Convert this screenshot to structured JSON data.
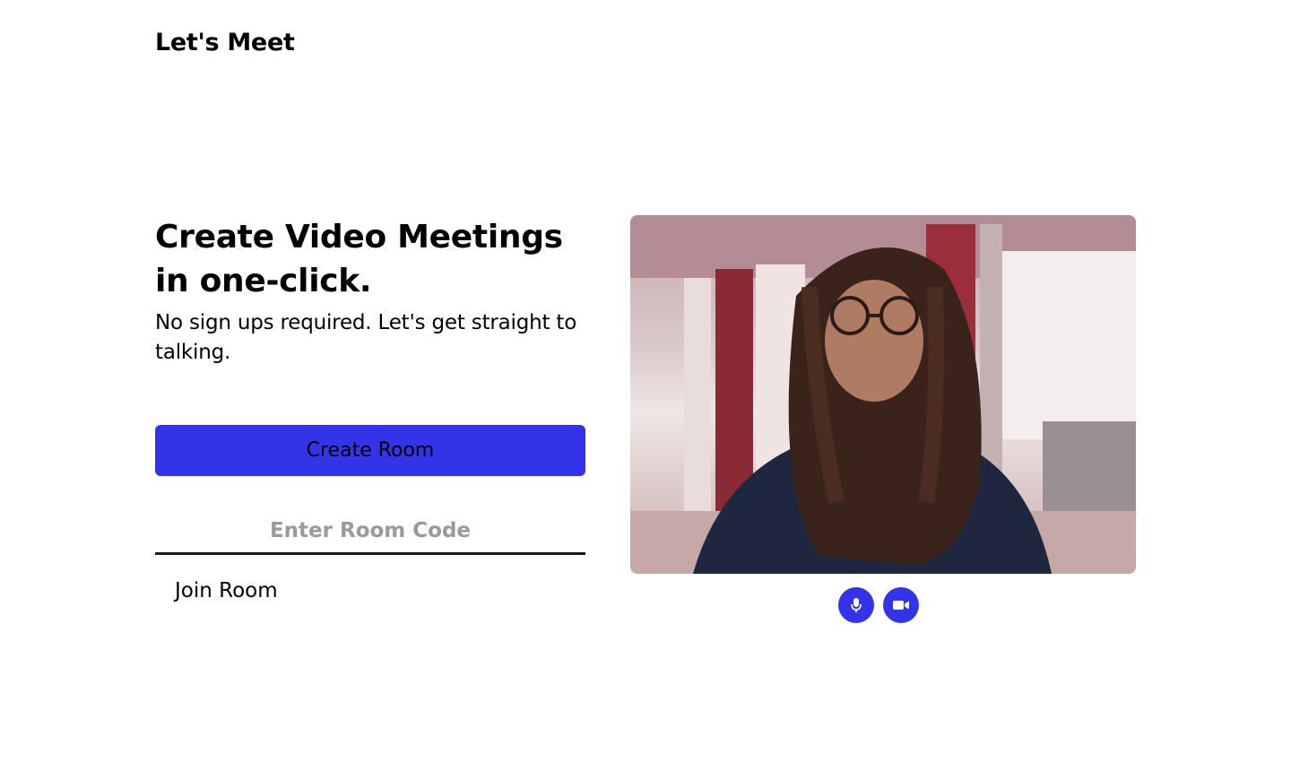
{
  "app": {
    "brand": "Let's Meet"
  },
  "hero": {
    "headline": "Create Video Meetings in one-click.",
    "subtext": "No sign ups required. Let's get straight to talking."
  },
  "actions": {
    "create_label": "Create Room",
    "room_code_placeholder": "Enter Room Code",
    "room_code_value": "",
    "join_label": "Join Room"
  },
  "media_controls": [
    {
      "icon": "microphone-icon"
    },
    {
      "icon": "video-camera-icon"
    }
  ],
  "colors": {
    "accent": "#3333ea",
    "text": "#000000",
    "placeholder": "#9a9a9a"
  }
}
